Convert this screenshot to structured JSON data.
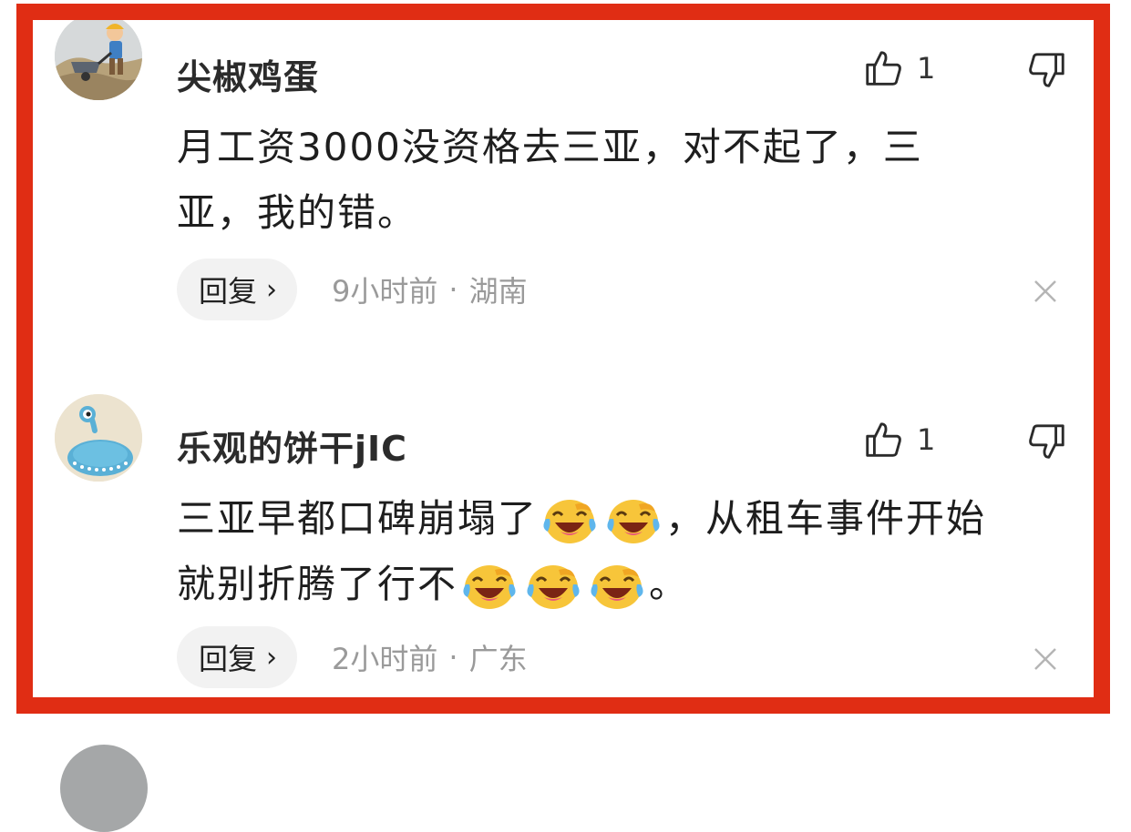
{
  "colors": {
    "frame_border": "#e02d14",
    "reply_bg": "#f2f2f2",
    "meta_text": "#9a9a9a"
  },
  "comments": [
    {
      "username": "尖椒鸡蛋",
      "avatar_icon": "worker-wheelbarrow-avatar",
      "likes": "1",
      "text_lines": [
        "月工资3000没资格去三亚，对不起了，三",
        "亚，我的错。"
      ],
      "reply_label": "回复",
      "time": "9小时前",
      "separator": "·",
      "location": "湖南"
    },
    {
      "username": "乐观的饼干jIC",
      "avatar_icon": "alien-cartoon-avatar",
      "likes": "1",
      "text_parts": {
        "line1_a": "三亚早都口碑崩塌了",
        "line1_b": "，从租车事件开始",
        "line2_a": "就别折腾了行不",
        "line2_b": "。"
      },
      "emoji_icon": "laughing-crying-emoji",
      "reply_label": "回复",
      "time": "2小时前",
      "separator": "·",
      "location": "广东"
    }
  ]
}
